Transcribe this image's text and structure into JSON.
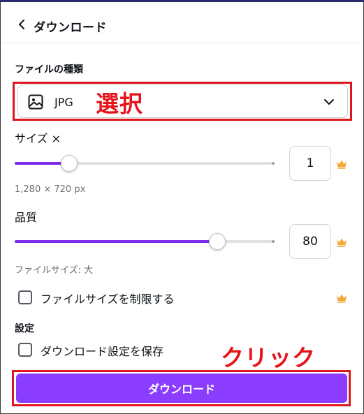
{
  "header": {
    "title": "ダウンロード",
    "back_icon": "chevron-left-icon"
  },
  "file_type": {
    "section_label": "ファイルの種類",
    "selected_value": "JPG",
    "icon": "image-icon",
    "dropdown_icon": "chevron-down-icon"
  },
  "size": {
    "label": "サイズ ×",
    "value": "1",
    "slider_fraction": 0.21,
    "dimensions": "1,280 × 720 px",
    "premium_icon": "crown-icon"
  },
  "quality": {
    "label": "品質",
    "value": "80",
    "slider_fraction": 0.78,
    "file_size_label": "ファイルサイズ: 大",
    "premium_icon": "crown-icon"
  },
  "limit_file_size": {
    "label": "ファイルサイズを制限する",
    "checked": false,
    "premium_icon": "crown-icon"
  },
  "settings": {
    "section_label": "設定",
    "save_settings_label": "ダウンロード設定を保存",
    "checked": false
  },
  "download_button": {
    "label": "ダウンロード"
  },
  "annotations": {
    "select_note": "選択",
    "click_note": "クリック",
    "color": "#e8141c"
  },
  "colors": {
    "accent": "#8b3dff",
    "slider_fill": "#7d2ae8",
    "crown": "#f4a93b"
  }
}
